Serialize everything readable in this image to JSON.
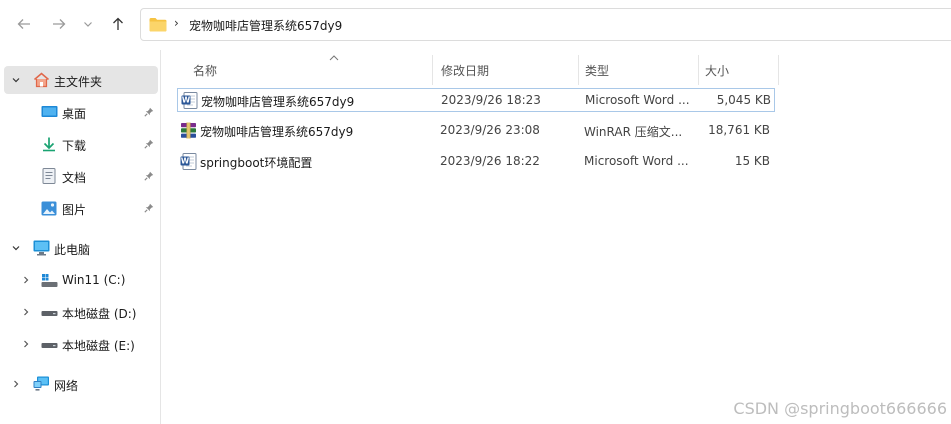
{
  "address": {
    "path": "宠物咖啡店管理系统657dy9"
  },
  "sidebar": {
    "items": [
      {
        "label": "主文件夹"
      },
      {
        "label": "桌面"
      },
      {
        "label": "下载"
      },
      {
        "label": "文档"
      },
      {
        "label": "图片"
      },
      {
        "label": "此电脑"
      },
      {
        "label": "Win11 (C:)"
      },
      {
        "label": "本地磁盘 (D:)"
      },
      {
        "label": "本地磁盘 (E:)"
      },
      {
        "label": "网络"
      }
    ]
  },
  "columns": {
    "name": "名称",
    "modified": "修改日期",
    "type": "类型",
    "size": "大小"
  },
  "files": [
    {
      "name": "宠物咖啡店管理系统657dy9",
      "modified": "2023/9/26 18:23",
      "type": "Microsoft Word ...",
      "size": "5,045 KB",
      "icon": "word-doc-icon"
    },
    {
      "name": "宠物咖啡店管理系统657dy9",
      "modified": "2023/9/26 23:08",
      "type": "WinRAR 压缩文...",
      "size": "18,761 KB",
      "icon": "winrar-archive-icon"
    },
    {
      "name": "springboot环境配置",
      "modified": "2023/9/26 18:22",
      "type": "Microsoft Word ...",
      "size": "15 KB",
      "icon": "word-doc-icon"
    }
  ],
  "watermark": "CSDN @springboot666666",
  "colors": {
    "accent": "#0067c0",
    "folder": "#f6c343",
    "selection": "#e5e5e5"
  }
}
